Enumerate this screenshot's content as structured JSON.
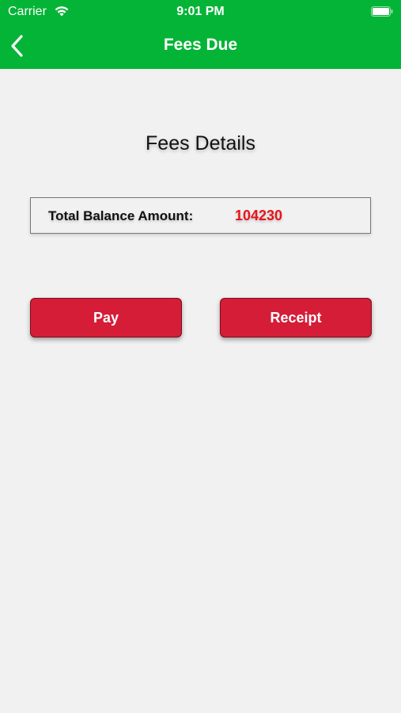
{
  "status_bar": {
    "carrier": "Carrier",
    "time": "9:01 PM",
    "icons": [
      "wifi-icon",
      "battery-icon"
    ]
  },
  "nav": {
    "title": "Fees Due",
    "back_icon": "chevron-left-icon",
    "background_color": "#04b436"
  },
  "main": {
    "section_title": "Fees Details",
    "balance": {
      "label": "Total Balance Amount:",
      "value": "104230",
      "value_color": "#e8141c"
    },
    "buttons": {
      "pay_label": "Pay",
      "receipt_label": "Receipt",
      "color": "#d51d37"
    }
  }
}
